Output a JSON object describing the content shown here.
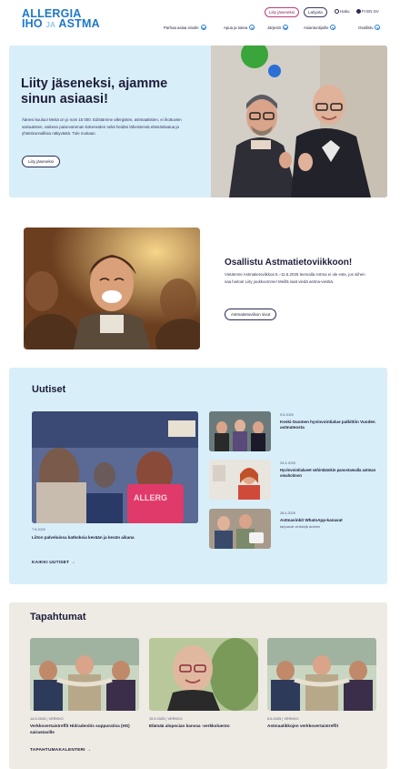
{
  "brand": {
    "line1": "ALLERGIA",
    "line2_a": "IHO",
    "line2_and": "JA",
    "line2_b": "ASTMA",
    "color": "#1e78c8"
  },
  "utility": {
    "join_label": "Liity jäseneksi",
    "donate_label": "Lahjoita",
    "search_label": "Haku",
    "languages": [
      "FI",
      "EN",
      "SV"
    ]
  },
  "nav": {
    "items": [
      {
        "label": "Parhaa asiaa sinulle"
      },
      {
        "label": "Apua ja tukea"
      },
      {
        "label": "Järjestö"
      },
      {
        "label": "Asiantuntijoille"
      },
      {
        "label": "Osallistu"
      }
    ]
  },
  "hero": {
    "title": "Liity jäseneksi, ajamme sinun asiaasi!",
    "text": "Äänesi kuuluu! Meitä on jo noin 15 000. Edistämme allergisten, astmaattisten, ei ihottuvien sairautisten, vaikean paisevamman kokeneiden sekä heidän läheistensä elämänlaatua ja yhteiskunnallisia näkyvästä. Tule mukaan.",
    "button_label": "Liity jäseneksi",
    "image_alt_icons": "people-photo"
  },
  "campaign": {
    "title": "Osallistu Astmatietoviikkoon!",
    "text": "Vietämme Astmatietoviikkoa 5.–11.5.2025 teemalla Astma ei ole este, jos siihen saa hoitoa! Liity joukkoomme! Meillä saat viedä astma-viestiä.",
    "button_label": "Astmatietoviikon sivut"
  },
  "news": {
    "heading": "Uutiset",
    "main": {
      "date": "7.5.2025",
      "title": "Liiton palveluissa katkoksia kevään ja kesän aikana"
    },
    "items": [
      {
        "date": "9.5.2025",
        "title": "Keski-Suomen hyvinvointialue palkittiin Vuoden astmateosta",
        "sub": ""
      },
      {
        "date": "29.4.2025",
        "title": "Hyvinvointialueet vähintäänkin panostamalla astman omahoitoon",
        "sub": ""
      },
      {
        "date": "28.4.2025",
        "title": "Astmavinkit WhatsApp-kanavat",
        "sub": "tarjoavat vinkkejä arkeen"
      }
    ],
    "more_label": "KAIKKI UUTISET"
  },
  "events": {
    "heading": "Tapahtumat",
    "items": [
      {
        "meta": "14.5.2025 | VERKKO",
        "title": "Verkkovertaistreffit Hidradenitis suppurativa (HS) sairastaville"
      },
      {
        "meta": "15.5.2025 | VERKKO",
        "title": "Elämää alopecian kanssa -verkkoluento"
      },
      {
        "meta": "5.6.2025 | VERKKO",
        "title": "Astmaatikkojen verkkovertaistreffit"
      }
    ],
    "more_label": "TAPAHTUMAKALENTERI"
  },
  "colors": {
    "accent_blue": "#1e78c8",
    "light_blue_bg": "#d8eef9",
    "beige_bg": "#eeebe4",
    "text_dark": "#1d1d3a"
  }
}
